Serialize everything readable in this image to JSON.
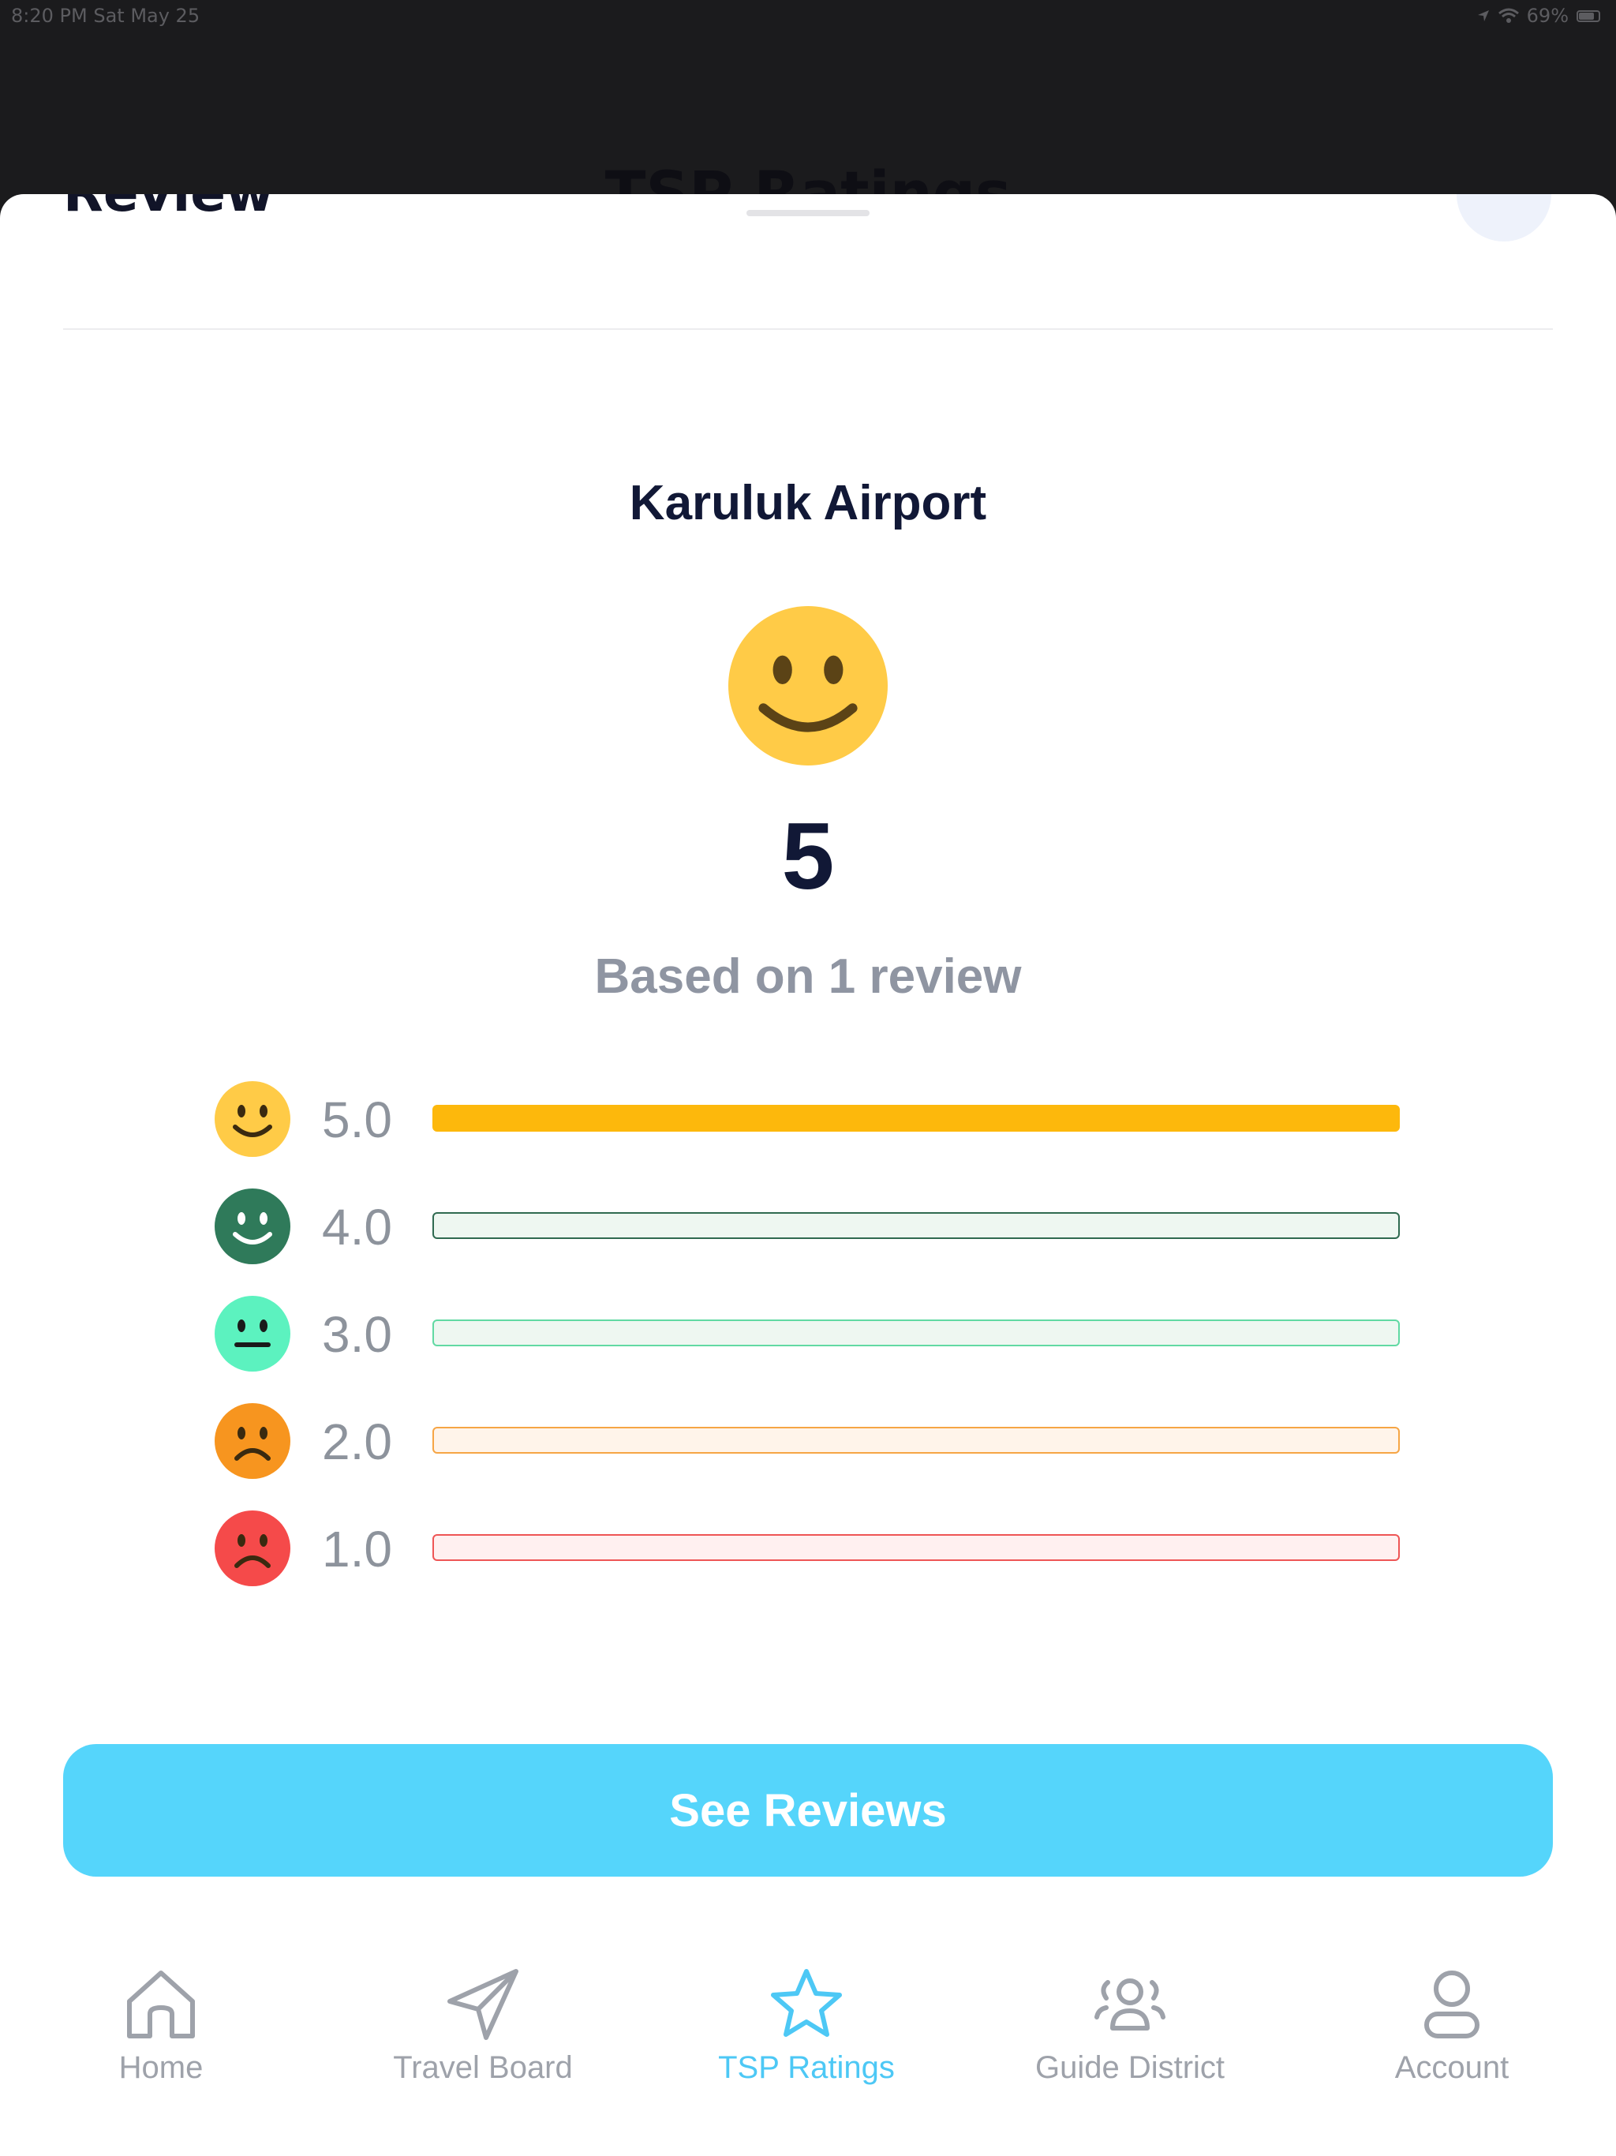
{
  "status_bar": {
    "time": "8:20 PM  Sat May 25",
    "battery": "69%"
  },
  "background_title": "TSP Ratings",
  "sheet": {
    "header_title": "Review",
    "provider_name": "Karuluk Airport",
    "overall_score": "5",
    "based_on": "Based on 1 review",
    "overall_face_icon": "smiley-face-icon",
    "ratings": [
      {
        "label": "5.0",
        "fraction": 1.0,
        "face_color": "#ffcb47",
        "fill_color": "#fdb80c",
        "border_color": "#fdb80c",
        "track_color": "#fdb80c",
        "mood": "happy"
      },
      {
        "label": "4.0",
        "fraction": 0.0,
        "face_color": "#2f7a5a",
        "fill_color": "#2f7a5a",
        "border_color": "#2f6a50",
        "track_color": "#eef7f1",
        "mood": "happy"
      },
      {
        "label": "3.0",
        "fraction": 0.0,
        "face_color": "#5cf2bf",
        "fill_color": "#5cf2bf",
        "border_color": "#61d9a3",
        "track_color": "#eef7f1",
        "mood": "neutral"
      },
      {
        "label": "2.0",
        "fraction": 0.0,
        "face_color": "#f7951f",
        "fill_color": "#f7951f",
        "border_color": "#f6a545",
        "track_color": "#fff4ea",
        "mood": "sad"
      },
      {
        "label": "1.0",
        "fraction": 0.0,
        "face_color": "#f54a4a",
        "fill_color": "#f54a4a",
        "border_color": "#ee5555",
        "track_color": "#fff0f0",
        "mood": "sad"
      }
    ],
    "see_reviews_label": "See Reviews"
  },
  "tabbar": {
    "items": [
      {
        "label": "Home",
        "icon": "home-icon",
        "active": false
      },
      {
        "label": "Travel Board",
        "icon": "paper-plane-icon",
        "active": false
      },
      {
        "label": "TSP Ratings",
        "icon": "star-icon",
        "active": true
      },
      {
        "label": "Guide District",
        "icon": "people-group-icon",
        "active": false
      },
      {
        "label": "Account",
        "icon": "user-icon",
        "active": false
      }
    ]
  },
  "colors": {
    "accent": "#55d5fb",
    "active_tab": "#4dc8f5",
    "inactive_tab": "#9ea2aa",
    "title": "#111836"
  }
}
